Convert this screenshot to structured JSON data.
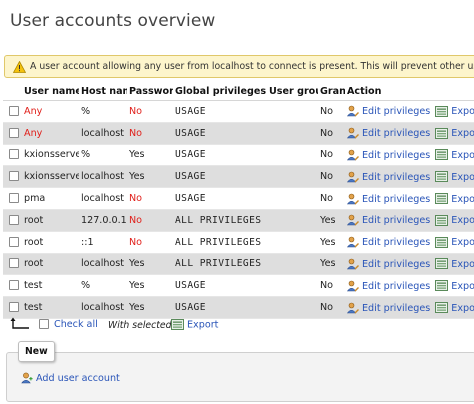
{
  "page_title": "User accounts overview",
  "notice": "A user account allowing any user from localhost to connect is present. This will prevent other users from connecting",
  "columns": {
    "user_name": "User name",
    "host_name": "Host name",
    "password": "Password",
    "global_privileges": "Global privileges",
    "user_group": "User group",
    "grant": "Grant",
    "action": "Action"
  },
  "rows": [
    {
      "user": "Any",
      "host": "%",
      "password": "No",
      "privileges": "USAGE",
      "group": "",
      "grant": "No",
      "edit": "Edit privileges",
      "export": "Export"
    },
    {
      "user": "Any",
      "host": "localhost",
      "password": "No",
      "privileges": "USAGE",
      "group": "",
      "grant": "No",
      "edit": "Edit privileges",
      "export": "Export"
    },
    {
      "user": "kxionsserver",
      "host": "%",
      "password": "Yes",
      "privileges": "USAGE",
      "group": "",
      "grant": "No",
      "edit": "Edit privileges",
      "export": "Export"
    },
    {
      "user": "kxionsserver",
      "host": "localhost",
      "password": "Yes",
      "privileges": "USAGE",
      "group": "",
      "grant": "No",
      "edit": "Edit privileges",
      "export": "Export"
    },
    {
      "user": "pma",
      "host": "localhost",
      "password": "No",
      "privileges": "USAGE",
      "group": "",
      "grant": "No",
      "edit": "Edit privileges",
      "export": "Export"
    },
    {
      "user": "root",
      "host": "127.0.0.1",
      "password": "No",
      "privileges": "ALL PRIVILEGES",
      "group": "",
      "grant": "Yes",
      "edit": "Edit privileges",
      "export": "Export"
    },
    {
      "user": "root",
      "host": "::1",
      "password": "No",
      "privileges": "ALL PRIVILEGES",
      "group": "",
      "grant": "Yes",
      "edit": "Edit privileges",
      "export": "Export"
    },
    {
      "user": "root",
      "host": "localhost",
      "password": "Yes",
      "privileges": "ALL PRIVILEGES",
      "group": "",
      "grant": "Yes",
      "edit": "Edit privileges",
      "export": "Export"
    },
    {
      "user": "test",
      "host": "%",
      "password": "Yes",
      "privileges": "USAGE",
      "group": "",
      "grant": "No",
      "edit": "Edit privileges",
      "export": "Export"
    },
    {
      "user": "test",
      "host": "localhost",
      "password": "Yes",
      "privileges": "USAGE",
      "group": "",
      "grant": "No",
      "edit": "Edit privileges",
      "export": "Export"
    }
  ],
  "footer": {
    "check_all": "Check all",
    "with_selected": "With selected:",
    "export": "Export"
  },
  "new_section": {
    "legend": "New",
    "add_user": "Add user account"
  },
  "colors": {
    "link": "#2a55b8",
    "warning_text": "#e0201b",
    "row_alt": "#dedede",
    "notice_bg": "#fdf5cc"
  },
  "icons": {
    "notice": "warning-icon",
    "help": "help-icon",
    "edit": "user-edit-icon",
    "export": "export-icon",
    "arrow": "arrow-up-left-icon",
    "add_user": "user-add-icon"
  }
}
